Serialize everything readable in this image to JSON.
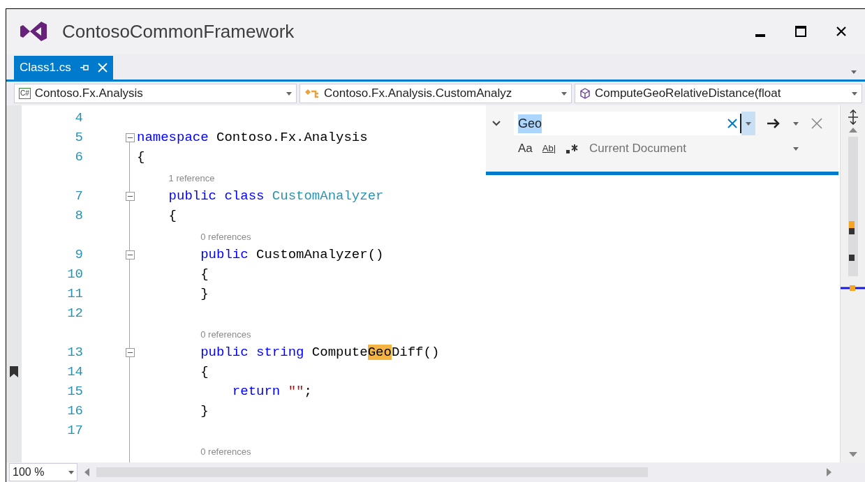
{
  "window": {
    "title": "ContosoCommonFramework"
  },
  "tabs": [
    {
      "label": "Class1.cs",
      "selected": true
    }
  ],
  "nav_bar": [
    {
      "kind": "project",
      "text": "Contoso.Fx.Analysis",
      "icon_text": "C#"
    },
    {
      "kind": "class",
      "text": "Contoso.Fx.Analysis.CustomAnalyz"
    },
    {
      "kind": "member",
      "text": "ComputeGeoRelativeDistance(float"
    }
  ],
  "find": {
    "value": "Geo",
    "scope": "Current Document",
    "match_case": "Aa",
    "whole_word": "Ab|"
  },
  "lines": [
    {
      "kind": "code",
      "number": "4",
      "fold": false,
      "bookmark": false
    },
    {
      "kind": "code",
      "number": "5",
      "fold": true,
      "bookmark": false,
      "tokens": [
        {
          "kind": "keyword",
          "text": "namespace"
        },
        {
          "kind": "plain",
          "text": " Contoso.Fx.Analysis"
        }
      ]
    },
    {
      "kind": "code",
      "number": "6",
      "fold": false,
      "bookmark": false,
      "tokens": [
        {
          "kind": "plain",
          "text": "{"
        }
      ]
    },
    {
      "kind": "lens",
      "text": "    1 reference"
    },
    {
      "kind": "code",
      "number": "7",
      "fold": true,
      "bookmark": false,
      "tokens": [
        {
          "kind": "keyword",
          "text": "    public class"
        },
        {
          "kind": "type",
          "text": " CustomAnalyzer"
        }
      ]
    },
    {
      "kind": "code",
      "number": "8",
      "fold": false,
      "bookmark": false,
      "tokens": [
        {
          "kind": "plain",
          "text": "    {"
        }
      ]
    },
    {
      "kind": "lens",
      "text": "        0 references"
    },
    {
      "kind": "code",
      "number": "9",
      "fold": true,
      "bookmark": false,
      "tokens": [
        {
          "kind": "keyword",
          "text": "        public"
        },
        {
          "kind": "plain",
          "text": " CustomAnalyzer()"
        }
      ]
    },
    {
      "kind": "code",
      "number": "10",
      "fold": false,
      "bookmark": false,
      "tokens": [
        {
          "kind": "plain",
          "text": "        {"
        }
      ]
    },
    {
      "kind": "code",
      "number": "11",
      "fold": false,
      "bookmark": false,
      "tokens": [
        {
          "kind": "plain",
          "text": "        }"
        }
      ]
    },
    {
      "kind": "code",
      "number": "12",
      "fold": false,
      "bookmark": false
    },
    {
      "kind": "lens",
      "text": "        0 references"
    },
    {
      "kind": "code",
      "number": "13",
      "fold": true,
      "bookmark": false,
      "tokens": [
        {
          "kind": "keyword",
          "text": "        public string"
        },
        {
          "kind": "plain",
          "text": " Compute"
        },
        {
          "kind": "match",
          "text": "Geo"
        },
        {
          "kind": "plain",
          "text": "Diff()"
        }
      ]
    },
    {
      "kind": "code",
      "number": "14",
      "fold": false,
      "bookmark": true,
      "tokens": [
        {
          "kind": "plain",
          "text": "        {"
        }
      ]
    },
    {
      "kind": "code",
      "number": "15",
      "fold": false,
      "bookmark": false,
      "tokens": [
        {
          "kind": "keyword",
          "text": "            return"
        },
        {
          "kind": "string",
          "text": " \"\""
        },
        {
          "kind": "plain",
          "text": ";"
        }
      ]
    },
    {
      "kind": "code",
      "number": "16",
      "fold": false,
      "bookmark": false,
      "tokens": [
        {
          "kind": "plain",
          "text": "        }"
        }
      ]
    },
    {
      "kind": "code",
      "number": "17",
      "fold": false,
      "bookmark": false
    },
    {
      "kind": "lens",
      "text": "        0 references"
    }
  ],
  "zoom": "100 %"
}
